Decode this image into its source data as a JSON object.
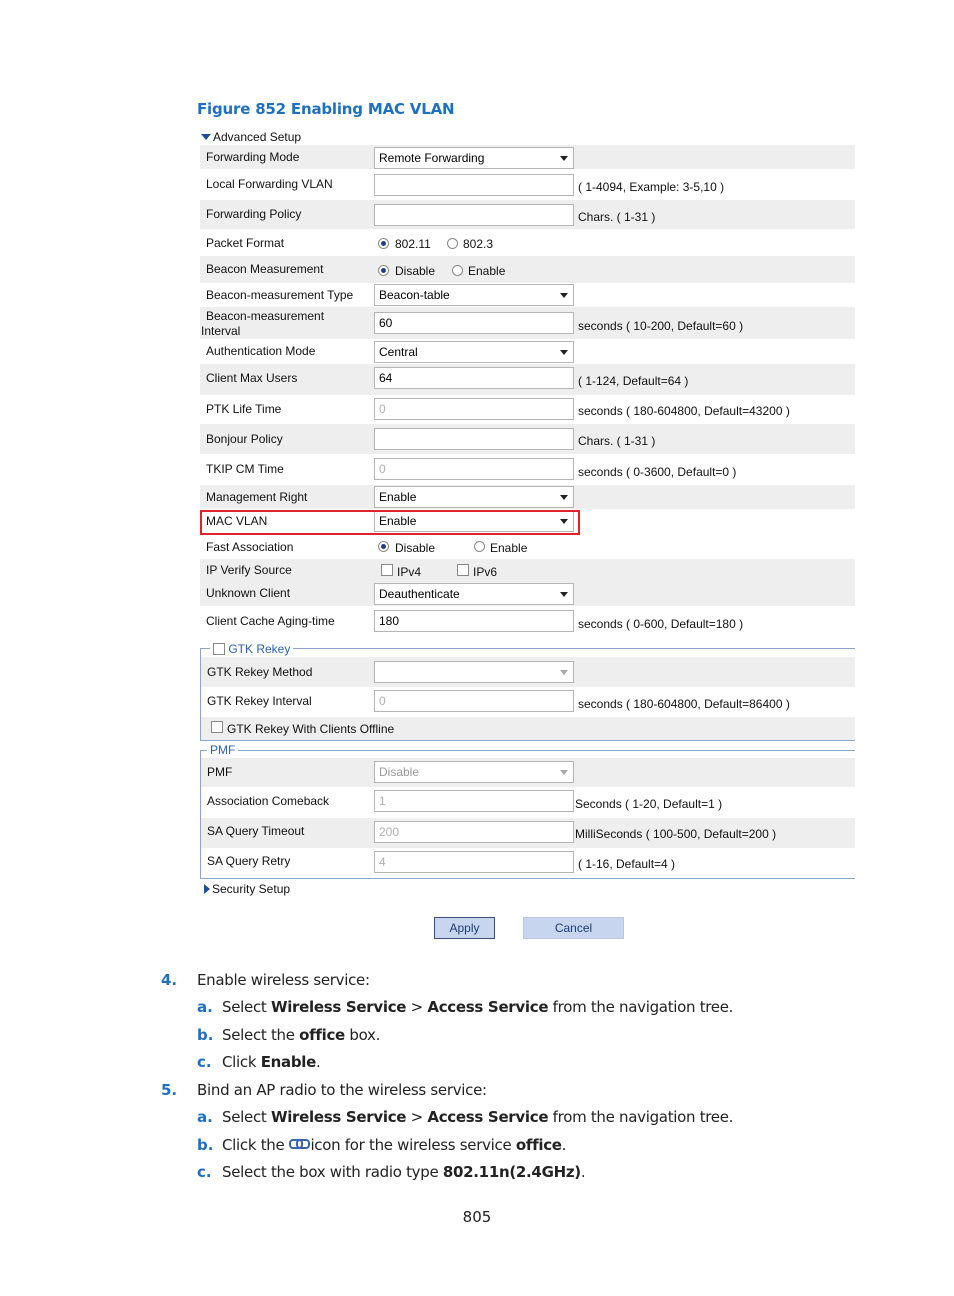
{
  "figure": {
    "title": "Figure 852 Enabling MAC VLAN"
  },
  "advanced_setup": {
    "label": "Advanced Setup"
  },
  "rows": {
    "forwarding_mode": {
      "label": "Forwarding Mode",
      "value": "Remote Forwarding"
    },
    "local_forwarding_vlan": {
      "label": "Local Forwarding VLAN",
      "value": "",
      "hint": "( 1-4094, Example: 3-5,10 )"
    },
    "forwarding_policy": {
      "label": "Forwarding Policy",
      "value": "",
      "hint": "Chars. ( 1-31 )"
    },
    "packet_format": {
      "label": "Packet Format",
      "option1": "802.11",
      "option2": "802.3",
      "selected": "802.11"
    },
    "beacon_measurement": {
      "label": "Beacon Measurement",
      "option1": "Disable",
      "option2": "Enable",
      "selected": "Disable"
    },
    "beacon_measurement_type": {
      "label": "Beacon-measurement Type",
      "value": "Beacon-table"
    },
    "beacon_measurement_interval": {
      "label_line1": "Beacon-measurement",
      "label_line2": "Interval",
      "value": "60",
      "hint": "seconds ( 10-200, Default=60 )"
    },
    "authentication_mode": {
      "label": "Authentication Mode",
      "value": "Central"
    },
    "client_max_users": {
      "label": "Client Max Users",
      "value": "64",
      "hint": "( 1-124, Default=64 )"
    },
    "ptk_life_time": {
      "label": "PTK Life Time",
      "value": "0",
      "hint": "seconds ( 180-604800, Default=43200 )"
    },
    "bonjour_policy": {
      "label": "Bonjour Policy",
      "value": "",
      "hint": "Chars. ( 1-31 )"
    },
    "tkip_cm_time": {
      "label": "TKIP CM Time",
      "value": "0",
      "hint": "seconds ( 0-3600, Default=0 )"
    },
    "management_right": {
      "label": "Management Right",
      "value": "Enable"
    },
    "mac_vlan": {
      "label": "MAC VLAN",
      "value": "Enable"
    },
    "fast_association": {
      "label": "Fast Association",
      "option1": "Disable",
      "option2": "Enable",
      "selected": "Disable"
    },
    "ip_verify_source": {
      "label": "IP Verify Source",
      "option1": "IPv4",
      "option2": "IPv6"
    },
    "unknown_client": {
      "label": "Unknown Client",
      "value": "Deauthenticate"
    },
    "client_cache_aging_time": {
      "label": "Client Cache Aging-time",
      "value": "180",
      "hint": "seconds ( 0-600, Default=180 )"
    }
  },
  "gtk_rekey": {
    "legend": "GTK Rekey",
    "method": {
      "label": "GTK Rekey Method",
      "value": ""
    },
    "interval": {
      "label": "GTK Rekey Interval",
      "value": "0",
      "hint": "seconds ( 180-604800, Default=86400 )"
    },
    "clients_offline": {
      "label": "GTK Rekey With Clients Offline"
    }
  },
  "pmf": {
    "legend": "PMF",
    "pmf": {
      "label": "PMF",
      "value": "Disable"
    },
    "association_comeback": {
      "label": "Association Comeback",
      "value": "1",
      "hint": "Seconds ( 1-20, Default=1 )"
    },
    "sa_query_timeout": {
      "label": "SA Query Timeout",
      "value": "200",
      "hint": "MilliSeconds ( 100-500, Default=200 )"
    },
    "sa_query_retry": {
      "label": "SA Query Retry",
      "value": "4",
      "hint": "( 1-16, Default=4 )"
    }
  },
  "security_setup": {
    "label": "Security Setup"
  },
  "buttons": {
    "apply": "Apply",
    "cancel": "Cancel"
  },
  "steps": {
    "s4": {
      "num": "4.",
      "text": "Enable wireless service:"
    },
    "s4a": {
      "num": "a.",
      "t1": "Select ",
      "b1": "Wireless Service",
      "t2": " > ",
      "b2": "Access Service",
      "t3": " from the navigation tree."
    },
    "s4b": {
      "num": "b.",
      "t1": "Select the ",
      "b1": "office",
      "t2": " box."
    },
    "s4c": {
      "num": "c.",
      "t1": "Click ",
      "b1": "Enable",
      "t2": "."
    },
    "s5": {
      "num": "5.",
      "text": "Bind an AP radio to the wireless service:"
    },
    "s5a": {
      "num": "a.",
      "t1": "Select ",
      "b1": "Wireless Service",
      "t2": " > ",
      "b2": "Access Service",
      "t3": " from the navigation tree."
    },
    "s5b": {
      "num": "b.",
      "t1": "Click the",
      "t2": "icon for the wireless service ",
      "b1": "office",
      "t3": "."
    },
    "s5c": {
      "num": "c.",
      "t1": "Select the box with radio type ",
      "b1": "802.11n(2.4GHz)",
      "t2": "."
    }
  },
  "page_number": "805"
}
